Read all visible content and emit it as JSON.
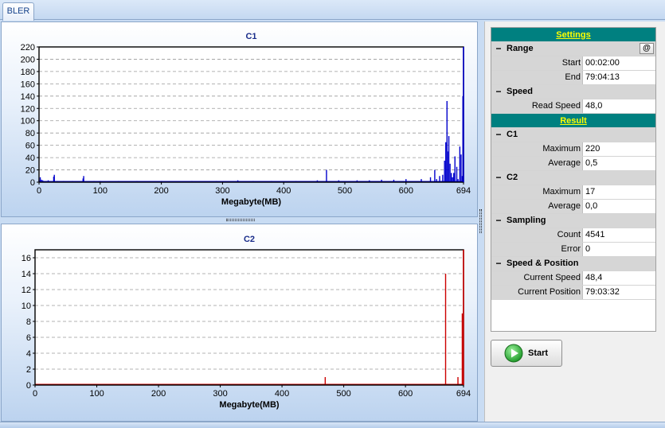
{
  "tab": {
    "label": "BLER"
  },
  "chart_data": [
    {
      "type": "bar",
      "title": "C1",
      "xlabel": "Megabyte(MB)",
      "ylabel": "",
      "xlim": [
        0,
        694
      ],
      "ylim": [
        0,
        220
      ],
      "xticks": [
        0,
        100,
        200,
        300,
        400,
        500,
        600,
        694
      ],
      "yticks": [
        0,
        20,
        40,
        60,
        80,
        100,
        120,
        140,
        160,
        180,
        200,
        220
      ],
      "color": "#0000cc",
      "grid": true,
      "x": [
        0,
        2,
        4,
        6,
        8,
        12,
        15,
        24,
        25,
        30,
        40,
        55,
        72,
        73,
        90,
        100,
        130,
        160,
        200,
        250,
        290,
        325,
        350,
        380,
        420,
        455,
        470,
        490,
        520,
        540,
        560,
        580,
        600,
        625,
        640,
        647,
        650,
        655,
        660,
        663,
        665,
        667,
        668,
        670,
        672,
        674,
        676,
        678,
        680,
        683,
        685,
        688,
        690,
        692,
        693
      ],
      "values": [
        3,
        8,
        4,
        3,
        2,
        2,
        3,
        9,
        12,
        2,
        2,
        2,
        6,
        10,
        2,
        2,
        2,
        2,
        2,
        2,
        2,
        3,
        2,
        2,
        2,
        3,
        20,
        3,
        3,
        3,
        4,
        4,
        5,
        5,
        8,
        20,
        5,
        10,
        12,
        35,
        65,
        132,
        50,
        75,
        30,
        15,
        8,
        15,
        42,
        25,
        5,
        58,
        45,
        10,
        140
      ]
    },
    {
      "type": "bar",
      "title": "C2",
      "xlabel": "Megabyte(MB)",
      "ylabel": "",
      "xlim": [
        0,
        694
      ],
      "ylim": [
        0,
        17
      ],
      "xticks": [
        0,
        100,
        200,
        300,
        400,
        500,
        600,
        694
      ],
      "yticks": [
        0,
        2,
        4,
        6,
        8,
        10,
        12,
        14,
        16
      ],
      "color": "#cc0000",
      "grid": true,
      "x": [
        470,
        665,
        685,
        692
      ],
      "values": [
        1,
        14,
        1,
        9
      ]
    }
  ],
  "settings": {
    "header": "Settings",
    "range": {
      "label": "Range",
      "at_button": "@",
      "start_label": "Start",
      "start_value": "00:02:00",
      "end_label": "End",
      "end_value": "79:04:13"
    },
    "speed": {
      "label": "Speed",
      "read_speed_label": "Read Speed",
      "read_speed_value": "48,0"
    }
  },
  "result": {
    "header": "Result",
    "c1": {
      "label": "C1",
      "max_label": "Maximum",
      "max_value": "220",
      "avg_label": "Average",
      "avg_value": "0,5"
    },
    "c2": {
      "label": "C2",
      "max_label": "Maximum",
      "max_value": "17",
      "avg_label": "Average",
      "avg_value": "0,0"
    },
    "sampling": {
      "label": "Sampling",
      "count_label": "Count",
      "count_value": "4541",
      "error_label": "Error",
      "error_value": "0"
    },
    "speed_position": {
      "label": "Speed & Position",
      "cur_speed_label": "Current Speed",
      "cur_speed_value": "48,4",
      "cur_pos_label": "Current Position",
      "cur_pos_value": "79:03:32"
    }
  },
  "controls": {
    "start_label": "Start",
    "start_icon": "play-icon"
  }
}
